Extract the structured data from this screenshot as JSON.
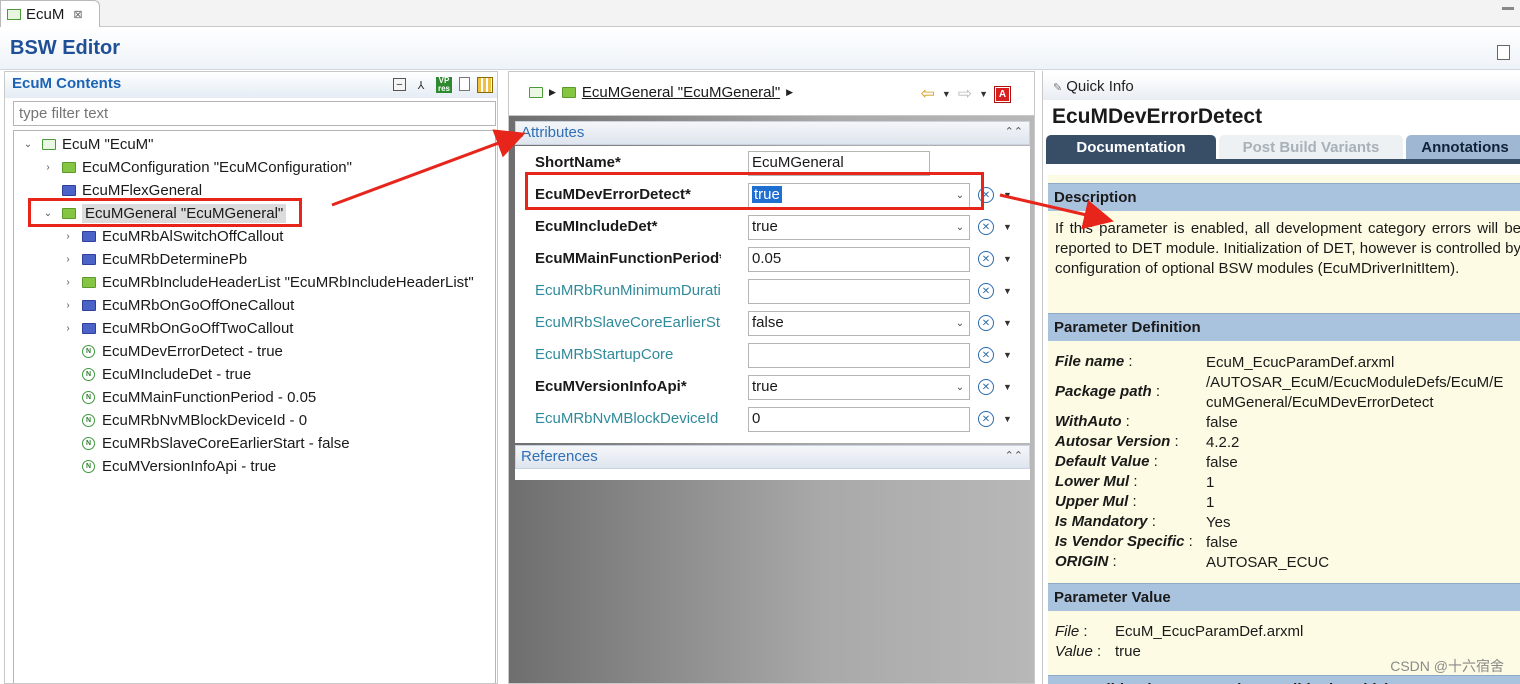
{
  "tab": {
    "label": "EcuM",
    "close": "⊠"
  },
  "editor": {
    "title": "BSW Editor"
  },
  "left": {
    "title": "EcuM Contents",
    "filter_placeholder": "type filter text",
    "tree": [
      {
        "label": "EcuM \"EcuM\"",
        "icon": "module-icon",
        "twisty": "expanded",
        "depth": 0
      },
      {
        "label": "EcuMConfiguration \"EcuMConfiguration\"",
        "icon": "green-folder-icon",
        "twisty": "collapsed",
        "depth": 1
      },
      {
        "label": "EcuMFlexGeneral",
        "icon": "blue-folder-icon",
        "twisty": "none",
        "depth": 1
      },
      {
        "label": "EcuMGeneral \"EcuMGeneral\"",
        "icon": "green-folder-icon",
        "twisty": "expanded",
        "depth": 1,
        "selected": true
      },
      {
        "label": "EcuMRbAlSwitchOffCallout",
        "icon": "blue-folder-icon",
        "twisty": "collapsed",
        "depth": 2
      },
      {
        "label": "EcuMRbDeterminePb",
        "icon": "blue-folder-icon",
        "twisty": "collapsed",
        "depth": 2
      },
      {
        "label": "EcuMRbIncludeHeaderList \"EcuMRbIncludeHeaderList\"",
        "icon": "green-folder-icon",
        "twisty": "collapsed",
        "depth": 2
      },
      {
        "label": "EcuMRbOnGoOffOneCallout",
        "icon": "blue-folder-icon",
        "twisty": "collapsed",
        "depth": 2
      },
      {
        "label": "EcuMRbOnGoOffTwoCallout",
        "icon": "blue-folder-icon",
        "twisty": "collapsed",
        "depth": 2
      },
      {
        "label": "EcuMDevErrorDetect - true",
        "icon": "parameter-icon",
        "twisty": "none",
        "depth": 2
      },
      {
        "label": "EcuMIncludeDet - true",
        "icon": "parameter-icon",
        "twisty": "none",
        "depth": 2
      },
      {
        "label": "EcuMMainFunctionPeriod - 0.05",
        "icon": "parameter-icon",
        "twisty": "none",
        "depth": 2
      },
      {
        "label": "EcuMRbNvMBlockDeviceId - 0",
        "icon": "parameter-icon",
        "twisty": "none",
        "depth": 2
      },
      {
        "label": "EcuMRbSlaveCoreEarlierStart - false",
        "icon": "parameter-icon",
        "twisty": "none",
        "depth": 2
      },
      {
        "label": "EcuMVersionInfoApi - true",
        "icon": "parameter-icon",
        "twisty": "none",
        "depth": 2
      }
    ]
  },
  "middle": {
    "breadcrumb": "EcuMGeneral \"EcuMGeneral\"",
    "attributes_title": "Attributes",
    "references_title": "References",
    "attributes": [
      {
        "label": "ShortName*",
        "value": "EcuMGeneral",
        "kind": "text",
        "required": true
      },
      {
        "label": "EcuMDevErrorDetect*",
        "value": "true",
        "kind": "combo",
        "required": true,
        "highlighted": true
      },
      {
        "label": "EcuMIncludeDet*",
        "value": "true",
        "kind": "combo",
        "required": true
      },
      {
        "label": "EcuMMainFunctionPeriod*",
        "value": "0.05",
        "kind": "text",
        "required": true
      },
      {
        "label": "EcuMRbRunMinimumDuration",
        "value": "",
        "kind": "text",
        "required": false
      },
      {
        "label": "EcuMRbSlaveCoreEarlierStart",
        "value": "false",
        "kind": "combo",
        "required": false
      },
      {
        "label": "EcuMRbStartupCore",
        "value": "",
        "kind": "text",
        "required": false
      },
      {
        "label": "EcuMVersionInfoApi*",
        "value": "true",
        "kind": "combo",
        "required": true
      },
      {
        "label": "EcuMRbNvMBlockDeviceId",
        "value": "0",
        "kind": "text",
        "required": false
      }
    ]
  },
  "right": {
    "panel_title": "Quick Info",
    "heading": "EcuMDevErrorDetect",
    "tabs": [
      "Documentation",
      "Post Build Variants",
      "Annotations"
    ],
    "description_title": "Description",
    "description": "If this parameter is enabled, all development category errors will be reported to DET module. Initialization of DET, however is controlled by configuration of optional BSW modules (EcuMDriverInitItem).",
    "param_def_title": "Parameter Definition",
    "param_def": [
      {
        "key": "File name",
        "value": "EcuM_EcucParamDef.arxml"
      },
      {
        "key": "Package path",
        "value": "/AUTOSAR_EcuM/EcucModuleDefs/EcuM/E\ncuMGeneral/EcuMDevErrorDetect"
      },
      {
        "key": "WithAuto",
        "value": "false"
      },
      {
        "key": "Autosar Version",
        "value": "4.2.2"
      },
      {
        "key": "Default Value",
        "value": "false"
      },
      {
        "key": "Lower Mul",
        "value": "1"
      },
      {
        "key": "Upper Mul",
        "value": "1"
      },
      {
        "key": "Is Mandatory",
        "value": "Yes"
      },
      {
        "key": "Is Vendor Specific",
        "value": "false"
      },
      {
        "key": "ORIGIN",
        "value": "AUTOSAR_ECUC"
      }
    ],
    "param_value_title": "Parameter Value",
    "param_value": [
      {
        "key": "File",
        "value": "EcuM_EcucParamDef.arxml"
      },
      {
        "key": "Value",
        "value": "true"
      }
    ],
    "next_section_partial": "PostBuildVariantSupport (PostBuildSelectable)"
  },
  "colors": {
    "annotation_red": "#e8251b",
    "brand_blue": "#1f4f96",
    "tab_dark": "#384e66"
  },
  "watermark": "CSDN @十六宿舍"
}
